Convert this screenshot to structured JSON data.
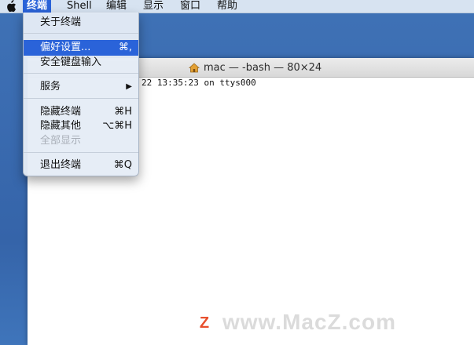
{
  "menubar": {
    "apple_icon": "apple-logo-icon",
    "items": [
      "终端",
      "Shell",
      "编辑",
      "显示",
      "窗口",
      "帮助"
    ],
    "active_index": 0
  },
  "menu": {
    "items": [
      {
        "label": "关于终端",
        "shortcut": ""
      },
      {
        "label": "偏好设置...",
        "shortcut": "⌘,"
      },
      {
        "label": "安全键盘输入",
        "shortcut": ""
      },
      {
        "label": "服务",
        "shortcut": "▶"
      },
      {
        "label": "隐藏终端",
        "shortcut": "⌘H"
      },
      {
        "label": "隐藏其他",
        "shortcut": "⌥⌘H"
      },
      {
        "label": "全部显示",
        "shortcut": ""
      },
      {
        "label": "退出终端",
        "shortcut": "⌘Q"
      }
    ],
    "highlighted_index": 1,
    "disabled_index": 6
  },
  "terminal": {
    "title": "mac — -bash — 80×24",
    "title_icon": "home-icon",
    "last_login_visible": "22 13:35:23 on ttys000"
  },
  "watermark": {
    "text": "www.MacZ.com",
    "logo_letter": "Z",
    "logo_color": "#e8502e"
  },
  "colors": {
    "highlight": "#2a63d9",
    "desktop": "#3a6bb0"
  }
}
